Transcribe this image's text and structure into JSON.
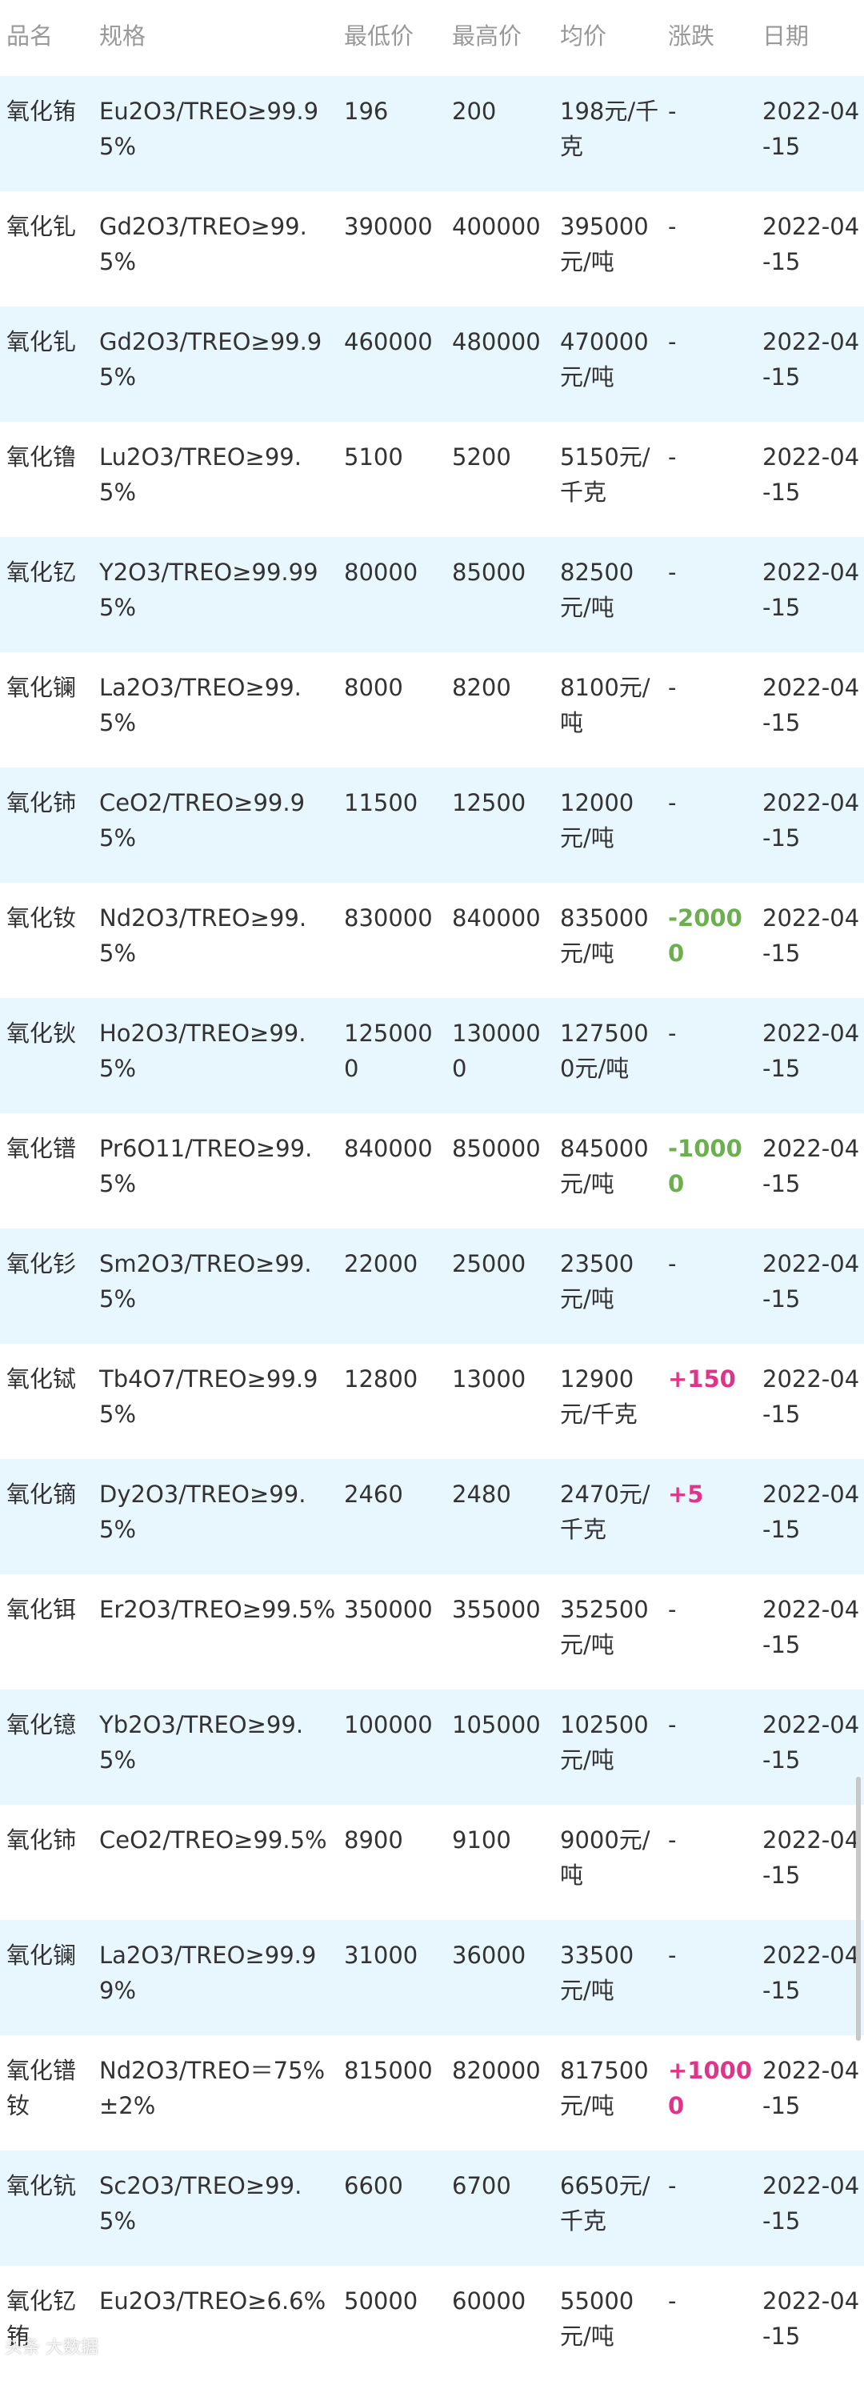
{
  "headers": {
    "name": "品名",
    "spec": "规格",
    "low": "最低价",
    "high": "最高价",
    "avg": "均价",
    "change": "涨跌",
    "date": "日期"
  },
  "rows": [
    {
      "name": "氧化铕",
      "spec": "Eu2O3/TREO≥99.95%",
      "low": "196",
      "high": "200",
      "avg": "198元/千克",
      "change": "-",
      "date": "2022-04-15"
    },
    {
      "name": "氧化钆",
      "spec": "Gd2O3/TREO≥99.5%",
      "low": "390000",
      "high": "400000",
      "avg": "395000元/吨",
      "change": "-",
      "date": "2022-04-15"
    },
    {
      "name": "氧化钆",
      "spec": "Gd2O3/TREO≥99.95%",
      "low": "460000",
      "high": "480000",
      "avg": "470000元/吨",
      "change": "-",
      "date": "2022-04-15"
    },
    {
      "name": "氧化镥",
      "spec": "Lu2O3/TREO≥99.5%",
      "low": "5100",
      "high": "5200",
      "avg": "5150元/千克",
      "change": "-",
      "date": "2022-04-15"
    },
    {
      "name": "氧化钇",
      "spec": "Y2O3/TREO≥99.995%",
      "low": "80000",
      "high": "85000",
      "avg": "82500元/吨",
      "change": "-",
      "date": "2022-04-15"
    },
    {
      "name": "氧化镧",
      "spec": "La2O3/TREO≥99.5%",
      "low": "8000",
      "high": "8200",
      "avg": "8100元/吨",
      "change": "-",
      "date": "2022-04-15"
    },
    {
      "name": "氧化铈",
      "spec": "CeO2/TREO≥99.95%",
      "low": "11500",
      "high": "12500",
      "avg": "12000元/吨",
      "change": "-",
      "date": "2022-04-15"
    },
    {
      "name": "氧化钕",
      "spec": "Nd2O3/TREO≥99.5%",
      "low": "830000",
      "high": "840000",
      "avg": "835000元/吨",
      "change": "-20000",
      "date": "2022-04-15"
    },
    {
      "name": "氧化钬",
      "spec": "Ho2O3/TREO≥99.5%",
      "low": "1250000",
      "high": "1300000",
      "avg": "1275000元/吨",
      "change": "-",
      "date": "2022-04-15"
    },
    {
      "name": "氧化镨",
      "spec": "Pr6O11/TREO≥99.5%",
      "low": "840000",
      "high": "850000",
      "avg": "845000元/吨",
      "change": "-10000",
      "date": "2022-04-15"
    },
    {
      "name": "氧化钐",
      "spec": "Sm2O3/TREO≥99.5%",
      "low": "22000",
      "high": "25000",
      "avg": "23500元/吨",
      "change": "-",
      "date": "2022-04-15"
    },
    {
      "name": "氧化铽",
      "spec": "Tb4O7/TREO≥99.95%",
      "low": "12800",
      "high": "13000",
      "avg": "12900元/千克",
      "change": "+150",
      "date": "2022-04-15"
    },
    {
      "name": "氧化镝",
      "spec": "Dy2O3/TREO≥99.5%",
      "low": "2460",
      "high": "2480",
      "avg": "2470元/千克",
      "change": "+5",
      "date": "2022-04-15"
    },
    {
      "name": "氧化铒",
      "spec": "Er2O3/TREO≥99.5%",
      "low": "350000",
      "high": "355000",
      "avg": "352500元/吨",
      "change": "-",
      "date": "2022-04-15"
    },
    {
      "name": "氧化镱",
      "spec": "Yb2O3/TREO≥99.5%",
      "low": "100000",
      "high": "105000",
      "avg": "102500元/吨",
      "change": "-",
      "date": "2022-04-15"
    },
    {
      "name": "氧化铈",
      "spec": "CeO2/TREO≥99.5%",
      "low": "8900",
      "high": "9100",
      "avg": "9000元/吨",
      "change": "-",
      "date": "2022-04-15"
    },
    {
      "name": "氧化镧",
      "spec": "La2O3/TREO≥99.99%",
      "low": "31000",
      "high": "36000",
      "avg": "33500元/吨",
      "change": "-",
      "date": "2022-04-15"
    },
    {
      "name": "氧化镨钕",
      "spec": "Nd2O3/TREO＝75%±2%",
      "low": "815000",
      "high": "820000",
      "avg": "817500元/吨",
      "change": "+10000",
      "date": "2022-04-15"
    },
    {
      "name": "氧化钪",
      "spec": "Sc2O3/TREO≥99.5%",
      "low": "6600",
      "high": "6700",
      "avg": "6650元/千克",
      "change": "-",
      "date": "2022-04-15"
    },
    {
      "name": "氧化钇铕",
      "spec": "Eu2O3/TREO≥6.6%",
      "low": "50000",
      "high": "60000",
      "avg": "55000元/吨",
      "change": "-",
      "date": "2022-04-15"
    }
  ],
  "colors": {
    "row_alt": "#e8f6fd",
    "up": "#e0338a",
    "down": "#6ab04c",
    "header_text": "#999999"
  },
  "watermark": "头条 大数据"
}
